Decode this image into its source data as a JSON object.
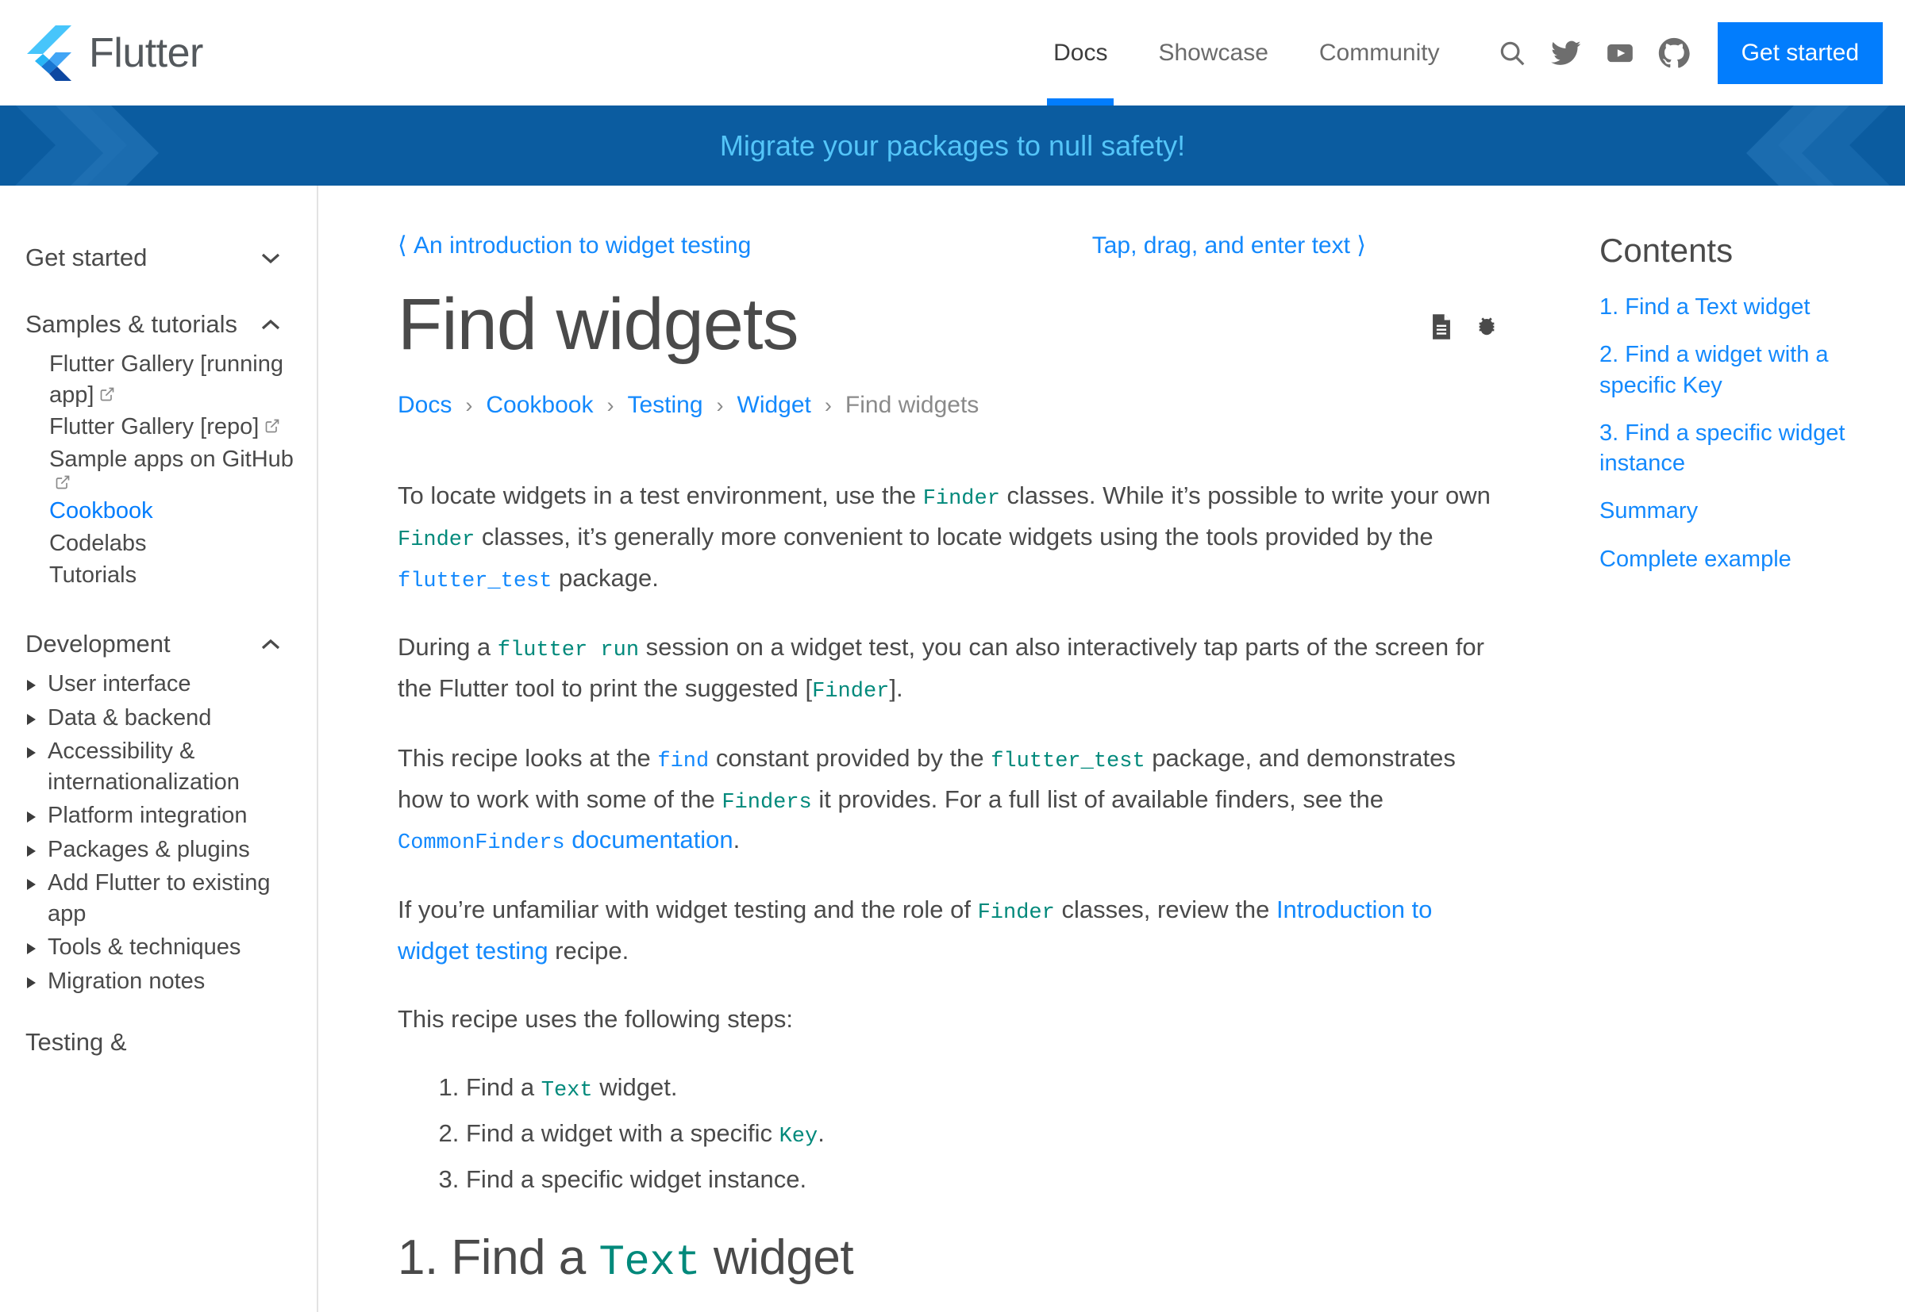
{
  "header": {
    "brand": "Flutter",
    "brand_logo_icon": "flutter-logo-icon",
    "nav": [
      {
        "label": "Docs",
        "active": true
      },
      {
        "label": "Showcase",
        "active": false
      },
      {
        "label": "Community",
        "active": false
      }
    ],
    "icons": [
      {
        "name": "search-icon"
      },
      {
        "name": "twitter-icon"
      },
      {
        "name": "youtube-icon"
      },
      {
        "name": "github-icon"
      }
    ],
    "cta": "Get started",
    "accent_color": "#027dfd"
  },
  "banner": {
    "text": "Migrate your packages to null safety!",
    "background_color": "#0b5ca0",
    "text_color": "#54c5f8"
  },
  "sidebar": {
    "sections": [
      {
        "label": "Get started",
        "state": "collapsed",
        "icon": "chevron-down-icon"
      },
      {
        "label": "Samples & tutorials",
        "state": "expanded",
        "icon": "chevron-up-icon"
      }
    ],
    "samples_items": [
      {
        "label": "Flutter Gallery [running app]",
        "external": true,
        "active": false
      },
      {
        "label": "Flutter Gallery [repo]",
        "external": true,
        "active": false
      },
      {
        "label": "Sample apps on GitHub",
        "external": true,
        "active": false
      },
      {
        "label": "Cookbook",
        "external": false,
        "active": true
      },
      {
        "label": "Codelabs",
        "external": false,
        "active": false
      },
      {
        "label": "Tutorials",
        "external": false,
        "active": false
      }
    ],
    "development": {
      "label": "Development",
      "state": "expanded",
      "icon": "chevron-up-icon"
    },
    "development_items": [
      {
        "label": "User interface"
      },
      {
        "label": "Data & backend"
      },
      {
        "label": "Accessibility & internationalization"
      },
      {
        "label": "Platform integration"
      },
      {
        "label": "Packages & plugins"
      },
      {
        "label": "Add Flutter to existing app"
      },
      {
        "label": "Tools & techniques"
      },
      {
        "label": "Migration notes"
      }
    ],
    "last_section": {
      "label": "Testing &"
    }
  },
  "main": {
    "pager": {
      "prev": "An introduction to widget testing",
      "prev_icon": "chevron-left-icon",
      "next": "Tap, drag, and enter text",
      "next_icon": "chevron-right-icon"
    },
    "title": "Find widgets",
    "actions": [
      {
        "name": "page-source-icon"
      },
      {
        "name": "bug-report-icon"
      }
    ],
    "breadcrumb": [
      {
        "label": "Docs",
        "link": true
      },
      {
        "label": "Cookbook",
        "link": true
      },
      {
        "label": "Testing",
        "link": true
      },
      {
        "label": "Widget",
        "link": true
      },
      {
        "label": "Find widgets",
        "link": false
      }
    ],
    "breadcrumb_separator": "›",
    "paragraphs": {
      "p1_a": "To locate widgets in a test environment, use the ",
      "p1_code1": "Finder",
      "p1_b": " classes. While it’s possible to write your own ",
      "p1_code2": "Finder",
      "p1_c": " classes, it’s generally more convenient to locate widgets using the tools provided by the ",
      "p1_code3": "flutter_test",
      "p1_d": " package.",
      "p2_a": "During a ",
      "p2_code1": "flutter run",
      "p2_b": " session on a widget test, you can also interactively tap parts of the screen for the Flutter tool to print the suggested [",
      "p2_code2": "Finder",
      "p2_c": "].",
      "p3_a": "This recipe looks at the ",
      "p3_code1": "find",
      "p3_b": " constant provided by the ",
      "p3_code2": "flutter_test",
      "p3_c": " package, and demonstrates how to work with some of the ",
      "p3_code3": "Finders",
      "p3_d": " it provides. For a full list of available finders, see the ",
      "p3_link_code": "CommonFinders",
      "p3_link_text": " documentation",
      "p3_e": ".",
      "p4_a": "If you’re unfamiliar with widget testing and the role of ",
      "p4_code1": "Finder",
      "p4_b": " classes, review the ",
      "p4_link": "Introduction to widget testing",
      "p4_c": " recipe.",
      "p5": "This recipe uses the following steps:"
    },
    "steps": [
      {
        "a": "Find a ",
        "code": "Text",
        "b": " widget."
      },
      {
        "a": "Find a widget with a specific ",
        "code": "Key",
        "b": "."
      },
      {
        "a": "Find a specific widget instance.",
        "code": "",
        "b": ""
      }
    ],
    "heading2": {
      "a": "1. Find a ",
      "code": "Text",
      "b": " widget"
    }
  },
  "toc": {
    "title": "Contents",
    "items": [
      "1. Find a Text widget",
      "2. Find a widget with a specific Key",
      "3. Find a specific widget instance",
      "Summary",
      "Complete example"
    ]
  }
}
